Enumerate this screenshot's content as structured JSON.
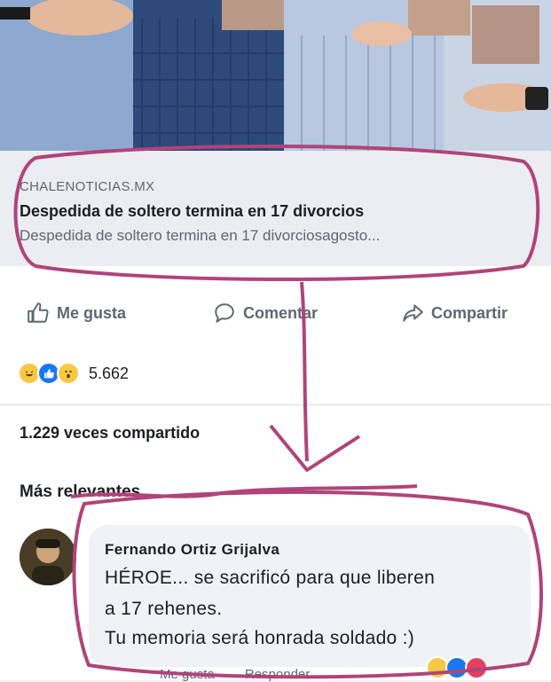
{
  "link": {
    "domain": "CHALENOTICIAS.MX",
    "title": "Despedida de soltero termina en 17 divorcios",
    "description": "Despedida de soltero termina en 17 divorciosagosto..."
  },
  "actions": {
    "like_label": "Me gusta",
    "comment_label": "Comentar",
    "share_label": "Compartir"
  },
  "reactions": {
    "icons": [
      "haha-reaction-icon",
      "like-reaction-icon",
      "wow-reaction-icon"
    ],
    "count": "5.662"
  },
  "shares": {
    "text": "1.229 veces compartido"
  },
  "comments": {
    "sort_label": "Más relevantes",
    "items": [
      {
        "author": "Fernando Ortiz Grijalva",
        "lines": [
          "HÉROE... se sacrificó para que liberen",
          "a 17 rehenes.",
          "Tu memoria será honrada soldado  :)"
        ],
        "footer": {
          "like_label": "Me gusta",
          "reply_label": "Responder"
        }
      }
    ]
  },
  "colors": {
    "annotation": "#b0447a",
    "like_blue": "#1877f2",
    "haha_yellow": "#f7c843",
    "love_red": "#e4405f"
  }
}
